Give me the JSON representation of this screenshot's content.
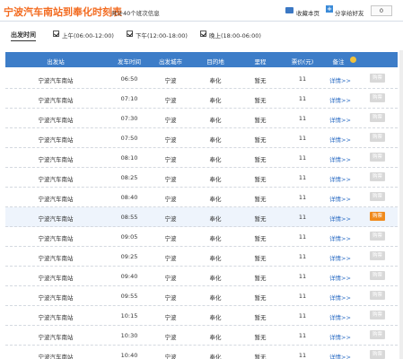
{
  "header": {
    "title": "宁波汽车南站到奉化时刻表",
    "subtitle": "共计40个班次信息",
    "favorite_label": "收藏本页",
    "share_label": "分享给好友",
    "share_count": "0",
    "share_icon_glyph": "+"
  },
  "filter": {
    "label": "出发时间",
    "options": [
      {
        "label": "上午(06:00-12:00)",
        "checked": true
      },
      {
        "label": "下午(12:00-18:00)",
        "checked": true
      },
      {
        "label": "晚上(18:00-06:00)",
        "checked": true
      }
    ]
  },
  "table": {
    "columns": [
      "出发站",
      "发车时间",
      "出发城市",
      "目的地",
      "里程",
      "票价(元)",
      "备注"
    ],
    "detail_label": "详情>>",
    "buy_label": "购票",
    "highlight_color": "#f08a1c",
    "rows": [
      {
        "station": "宁波汽车南站",
        "time": "06:50",
        "city": "宁波",
        "dest": "奉化",
        "mileage": "暂无",
        "price": "11",
        "highlight": false
      },
      {
        "station": "宁波汽车南站",
        "time": "07:10",
        "city": "宁波",
        "dest": "奉化",
        "mileage": "暂无",
        "price": "11",
        "highlight": false
      },
      {
        "station": "宁波汽车南站",
        "time": "07:30",
        "city": "宁波",
        "dest": "奉化",
        "mileage": "暂无",
        "price": "11",
        "highlight": false
      },
      {
        "station": "宁波汽车南站",
        "time": "07:50",
        "city": "宁波",
        "dest": "奉化",
        "mileage": "暂无",
        "price": "11",
        "highlight": false
      },
      {
        "station": "宁波汽车南站",
        "time": "08:10",
        "city": "宁波",
        "dest": "奉化",
        "mileage": "暂无",
        "price": "11",
        "highlight": false
      },
      {
        "station": "宁波汽车南站",
        "time": "08:25",
        "city": "宁波",
        "dest": "奉化",
        "mileage": "暂无",
        "price": "11",
        "highlight": false
      },
      {
        "station": "宁波汽车南站",
        "time": "08:40",
        "city": "宁波",
        "dest": "奉化",
        "mileage": "暂无",
        "price": "11",
        "highlight": false
      },
      {
        "station": "宁波汽车南站",
        "time": "08:55",
        "city": "宁波",
        "dest": "奉化",
        "mileage": "暂无",
        "price": "11",
        "highlight": true
      },
      {
        "station": "宁波汽车南站",
        "time": "09:05",
        "city": "宁波",
        "dest": "奉化",
        "mileage": "暂无",
        "price": "11",
        "highlight": false
      },
      {
        "station": "宁波汽车南站",
        "time": "09:25",
        "city": "宁波",
        "dest": "奉化",
        "mileage": "暂无",
        "price": "11",
        "highlight": false
      },
      {
        "station": "宁波汽车南站",
        "time": "09:40",
        "city": "宁波",
        "dest": "奉化",
        "mileage": "暂无",
        "price": "11",
        "highlight": false
      },
      {
        "station": "宁波汽车南站",
        "time": "09:55",
        "city": "宁波",
        "dest": "奉化",
        "mileage": "暂无",
        "price": "11",
        "highlight": false
      },
      {
        "station": "宁波汽车南站",
        "time": "10:15",
        "city": "宁波",
        "dest": "奉化",
        "mileage": "暂无",
        "price": "11",
        "highlight": false
      },
      {
        "station": "宁波汽车南站",
        "time": "10:30",
        "city": "宁波",
        "dest": "奉化",
        "mileage": "暂无",
        "price": "11",
        "highlight": false
      },
      {
        "station": "宁波汽车南站",
        "time": "10:40",
        "city": "宁波",
        "dest": "奉化",
        "mileage": "暂无",
        "price": "11",
        "highlight": false
      }
    ]
  }
}
